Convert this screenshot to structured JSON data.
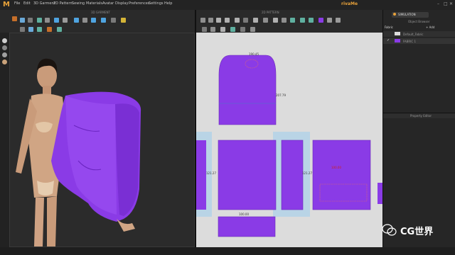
{
  "app": {
    "logo": "M",
    "brand": "rivaMe",
    "window_controls": [
      "–",
      "□",
      "✕"
    ]
  },
  "menu": [
    "File",
    "Edit",
    "3D Garment",
    "2D Pattern",
    "Sewing",
    "Materials",
    "Avatar",
    "Display",
    "Preferences",
    "Settings",
    "Help"
  ],
  "viewports": {
    "left_title": "3D GARMENT",
    "right_title": "2D PATTERN"
  },
  "right_panel": {
    "mode_button": "SIMULATION",
    "tabs": [
      "Object Browser",
      "Fabric"
    ],
    "add_label": "+ Add",
    "fabrics": [
      "Default_Fabric",
      "FABRIC 1"
    ],
    "property_title": "Property Editor"
  },
  "pattern_labels": {
    "top_width": "190.45",
    "top_side": "207.79",
    "side_left": "121.27",
    "side_right": "121.27",
    "bottom": "100.00",
    "center": "100.00"
  },
  "watermark": "CG世界",
  "colors": {
    "fabric": "#8a3be6",
    "pattern_bg": "#dcdcdc",
    "accent": "#e8a23a"
  }
}
